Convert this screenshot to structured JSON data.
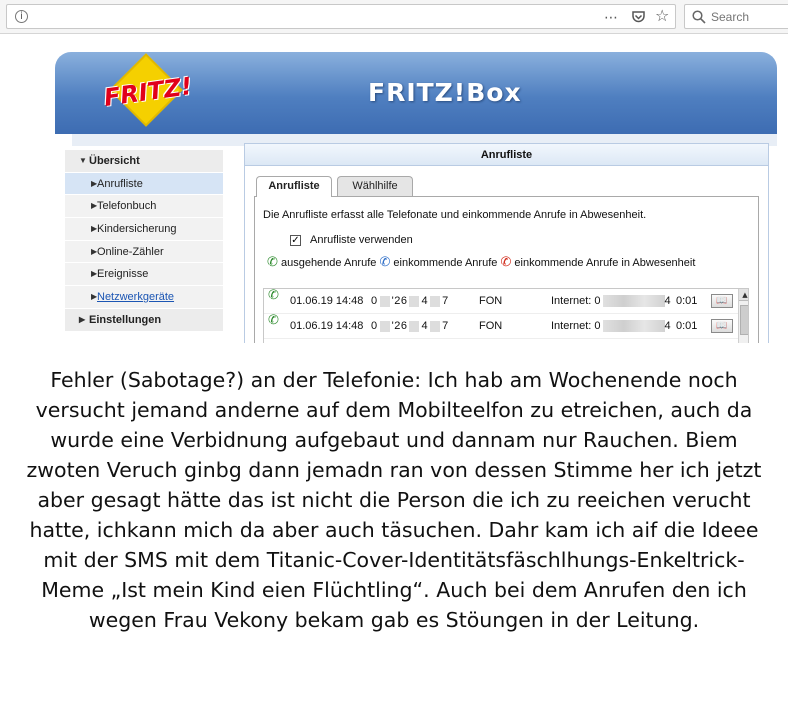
{
  "browser": {
    "menu_icon": "⋯",
    "search_placeholder": "Search"
  },
  "header": {
    "logo_text": "FRITZ!",
    "title": "FRITZ!Box"
  },
  "sidebar": {
    "sections": [
      {
        "label": "Übersicht",
        "expanded": true
      },
      {
        "label": "Einstellungen",
        "expanded": false
      }
    ],
    "items": [
      {
        "label": "Anrufliste",
        "active": true
      },
      {
        "label": "Telefonbuch"
      },
      {
        "label": "Kindersicherung"
      },
      {
        "label": "Online-Zähler"
      },
      {
        "label": "Ereignisse"
      },
      {
        "label": "Netzwerkgeräte",
        "link": true
      }
    ]
  },
  "panel": {
    "title": "Anrufliste",
    "tabs": [
      "Anrufliste",
      "Wählhilfe"
    ],
    "description": "Die Anrufliste erfasst alle Telefonate und einkommende Anrufe in Abwesenheit.",
    "checkbox_label": "Anrufliste verwenden",
    "checkbox_checked": true,
    "legend": {
      "outgoing": "ausgehende Anrufe",
      "incoming": "einkommende Anrufe",
      "missed": "einkommende Anrufe in Abwesenheit"
    },
    "calls": [
      {
        "date": "01.06.19 14:48",
        "num_a": "0",
        "num_b": "'26",
        "num_c": "4",
        "num_d": "7",
        "device": "FON",
        "line": "Internet: 0",
        "line_end": "4",
        "duration": "0:01"
      },
      {
        "date": "01.06.19 14:48",
        "num_a": "0",
        "num_b": "'26",
        "num_c": "4",
        "num_d": "7",
        "device": "FON",
        "line": "Internet: 0",
        "line_end": "4",
        "duration": "0:01"
      }
    ]
  },
  "caption": {
    "text": "Fehler (Sabotage?) an der Telefonie: Ich hab am Wochenende noch versucht jemand anderne auf dem Mobilteelfon zu etreichen, auch da wurde eine Verbidnung aufgebaut und dannam nur Rauchen. Biem zwoten Veruch ginbg dann jemadn ran von dessen Stimme her ich jetzt aber gesagt hätte das ist nicht die Person die ich zu reeichen verucht hatte, ichkann mich da aber auch täsuchen. Dahr kam ich aif die Ideee mit der SMS mit dem Titanic-Cover-Identitätsfäschlhungs-Enkeltrick-Meme „Ist mein Kind eien Flüchtling“. Auch bei dem Anrufen den ich wegen Frau Vekony bekam gab es Stöungen in der Leitung."
  }
}
